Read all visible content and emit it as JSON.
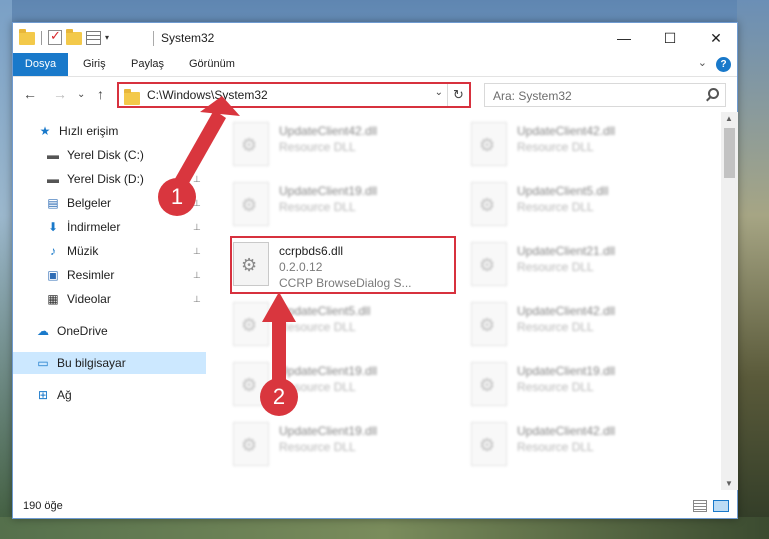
{
  "window": {
    "title": "System32",
    "controls": {
      "minimize": "—",
      "maximize": "☐",
      "close": "✕"
    }
  },
  "ribbon": {
    "tabs": [
      {
        "label": "Dosya",
        "active": true
      },
      {
        "label": "Giriş"
      },
      {
        "label": "Paylaş"
      },
      {
        "label": "Görünüm"
      }
    ],
    "help": "?",
    "expand": "⌄"
  },
  "nav": {
    "back": "←",
    "forward": "→",
    "recent": "⌄",
    "up": "↑",
    "address": "C:\\Windows\\System32",
    "address_dropdown": "⌄",
    "refresh": "↻",
    "search_placeholder": "Ara: System32"
  },
  "sidebar": {
    "items": [
      {
        "label": "Hızlı erişim",
        "icon": "star-icon",
        "glyph": "★"
      },
      {
        "label": "Yerel Disk (C:)",
        "icon": "drive-icon",
        "glyph": "▬",
        "pinned": true
      },
      {
        "label": "Yerel Disk (D:)",
        "icon": "drive-icon",
        "glyph": "▬",
        "pinned": true
      },
      {
        "label": "Belgeler",
        "icon": "documents-icon",
        "glyph": "▤",
        "pinned": true
      },
      {
        "label": "İndirmeler",
        "icon": "download-icon",
        "glyph": "⬇",
        "pinned": true
      },
      {
        "label": "Müzik",
        "icon": "music-icon",
        "glyph": "♪",
        "pinned": true
      },
      {
        "label": "Resimler",
        "icon": "pictures-icon",
        "glyph": "▣",
        "pinned": true
      },
      {
        "label": "Videolar",
        "icon": "videos-icon",
        "glyph": "▦",
        "pinned": true
      },
      {
        "label": "OneDrive",
        "icon": "onedrive-icon",
        "glyph": "☁"
      },
      {
        "label": "Bu bilgisayar",
        "icon": "computer-icon",
        "glyph": "▭",
        "selected": true
      },
      {
        "label": "Ağ",
        "icon": "network-icon",
        "glyph": "⊞"
      }
    ],
    "pin_glyph": "📌"
  },
  "files": {
    "left": [
      {
        "name": "UpdateClient42.dll",
        "desc": "Resource DLL"
      },
      {
        "name": "UpdateClient19.dll",
        "desc": "Resource DLL"
      },
      {
        "name": "ccrpbds6.dll",
        "version": "0.2.0.12",
        "desc": "CCRP BrowseDialog S..."
      },
      {
        "name": "UpdateClient5.dll",
        "desc": "Resource DLL"
      },
      {
        "name": "UpdateClient19.dll",
        "desc": "Resource DLL"
      },
      {
        "name": "UpdateClient19.dll",
        "desc": "Resource DLL"
      }
    ],
    "right": [
      {
        "name": "UpdateClient42.dll",
        "desc": "Resource DLL"
      },
      {
        "name": "UpdateClient5.dll",
        "desc": "Resource DLL"
      },
      {
        "name": "UpdateClient21.dll",
        "desc": "Resource DLL"
      },
      {
        "name": "UpdateClient42.dll",
        "desc": "Resource DLL"
      },
      {
        "name": "UpdateClient19.dll",
        "desc": "Resource DLL"
      },
      {
        "name": "UpdateClient42.dll",
        "desc": "Resource DLL"
      }
    ]
  },
  "status": {
    "count": "190 öğe"
  },
  "annotations": {
    "badge1": "1",
    "badge2": "2",
    "color": "#d9363e"
  }
}
